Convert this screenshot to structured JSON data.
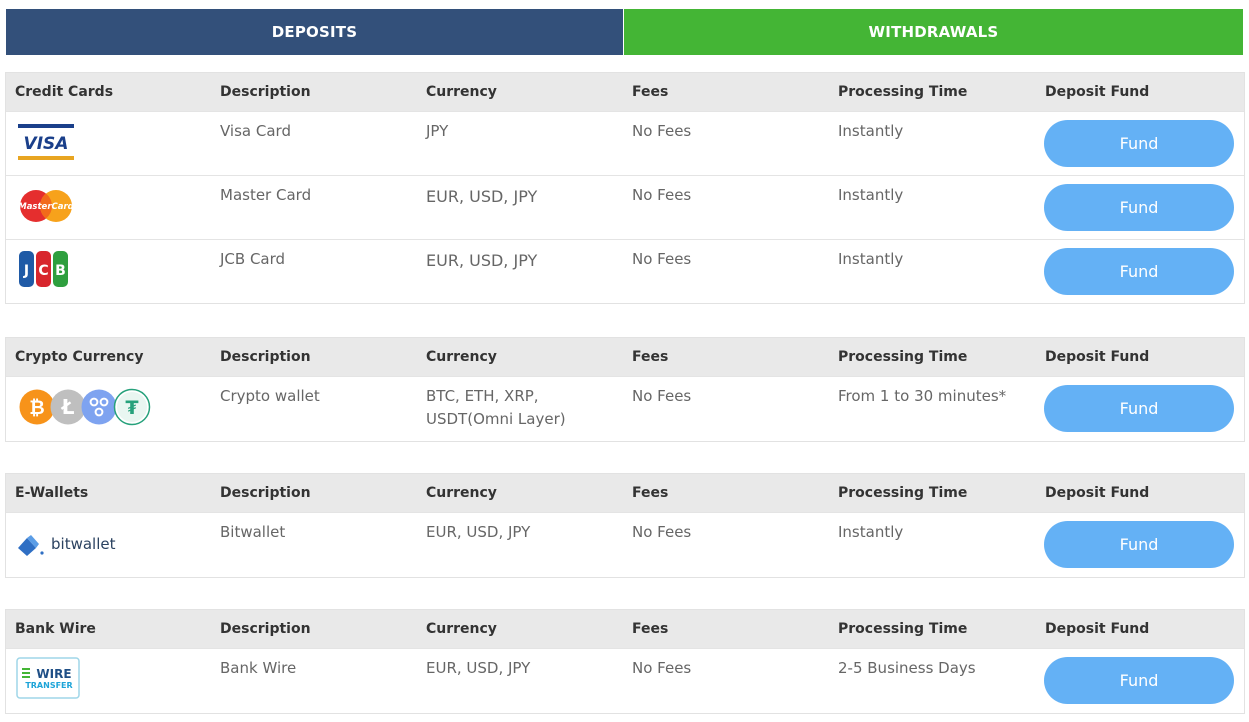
{
  "tabs": {
    "deposits": "DEPOSITS",
    "withdrawals": "WITHDRAWALS"
  },
  "headers": {
    "description": "Description",
    "currency": "Currency",
    "fees": "Fees",
    "processing": "Processing Time",
    "deposit_fund": "Deposit Fund"
  },
  "fund_label": "Fund",
  "colors": {
    "deposits_tab": "#33507a",
    "withdrawals_tab": "#44b535",
    "fund_button": "#64b1f5",
    "header_bg": "#e9e9e9"
  },
  "sections": [
    {
      "title": "Credit Cards",
      "rows": [
        {
          "logo": "visa-logo",
          "description": "Visa Card",
          "currency": "JPY",
          "fees": "No Fees",
          "processing": "Instantly"
        },
        {
          "logo": "mastercard-logo",
          "logo_text": "MasterCard",
          "description": "Master Card",
          "currency": "EUR, USD, JPY",
          "fees": "No Fees",
          "processing": "Instantly"
        },
        {
          "logo": "jcb-logo",
          "logo_text": "JCB",
          "description": "JCB Card",
          "currency": "EUR, USD, JPY",
          "fees": "No Fees",
          "processing": "Instantly"
        }
      ]
    },
    {
      "title": "Crypto Currency",
      "rows": [
        {
          "logo": "crypto-logos",
          "description": "Crypto wallet",
          "currency_line1": "BTC, ETH, XRP,",
          "currency_line2": "USDT(Omni Layer)",
          "fees": "No Fees",
          "processing": "From 1 to 30 minutes*"
        }
      ]
    },
    {
      "title": "E-Wallets",
      "rows": [
        {
          "logo": "bitwallet-logo",
          "logo_text": "bitwallet",
          "description": "Bitwallet",
          "currency": "EUR, USD, JPY",
          "fees": "No Fees",
          "processing": "Instantly"
        }
      ]
    },
    {
      "title": "Bank Wire",
      "rows": [
        {
          "logo": "wire-transfer-logo",
          "logo_text_1": "WIRE",
          "logo_text_2": "TRANSFER",
          "description": "Bank Wire",
          "currency": "EUR, USD, JPY",
          "fees": "No Fees",
          "processing": "2-5 Business Days"
        }
      ]
    }
  ]
}
